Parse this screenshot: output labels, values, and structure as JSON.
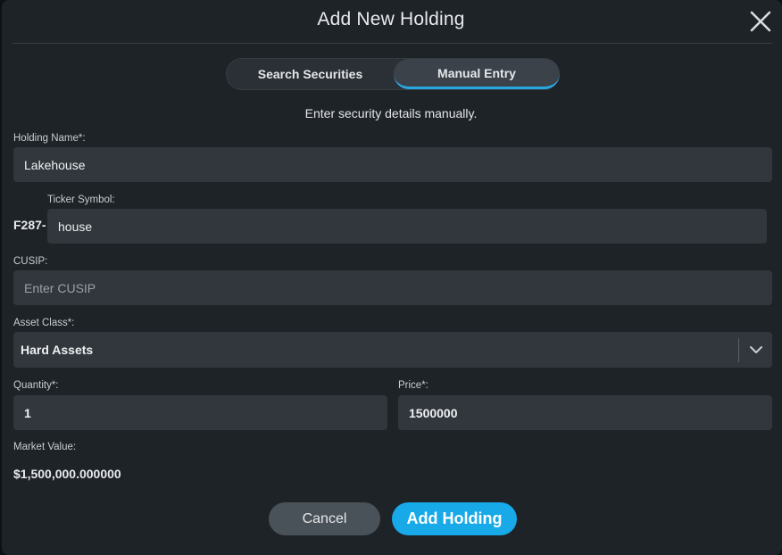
{
  "modal": {
    "title": "Add New Holding",
    "close_icon": "close-icon"
  },
  "tabs": [
    {
      "label": "Search Securities",
      "active": false
    },
    {
      "label": "Manual Entry",
      "active": true
    }
  ],
  "subtitle": "Enter security details manually.",
  "form": {
    "holding_name": {
      "label": "Holding Name*:",
      "value": "Lakehouse"
    },
    "ticker": {
      "label": "Ticker Symbol:",
      "prefix": "F287-",
      "value": "house"
    },
    "cusip": {
      "label": "CUSIP:",
      "value": "",
      "placeholder": "Enter CUSIP"
    },
    "asset_class": {
      "label": "Asset Class*:",
      "value": "Hard Assets",
      "icon": "chevron-down-icon"
    },
    "quantity": {
      "label": "Quantity*:",
      "value": "1"
    },
    "price": {
      "label": "Price*:",
      "value": "1500000"
    },
    "market_value": {
      "label": "Market Value:",
      "value": "$1,500,000.000000"
    }
  },
  "buttons": {
    "cancel": "Cancel",
    "add": "Add Holding"
  },
  "colors": {
    "modal_bg": "#1e2328",
    "field_bg": "#31373d",
    "accent": "#17a9e8",
    "tab_underline": "#29a8e0"
  }
}
